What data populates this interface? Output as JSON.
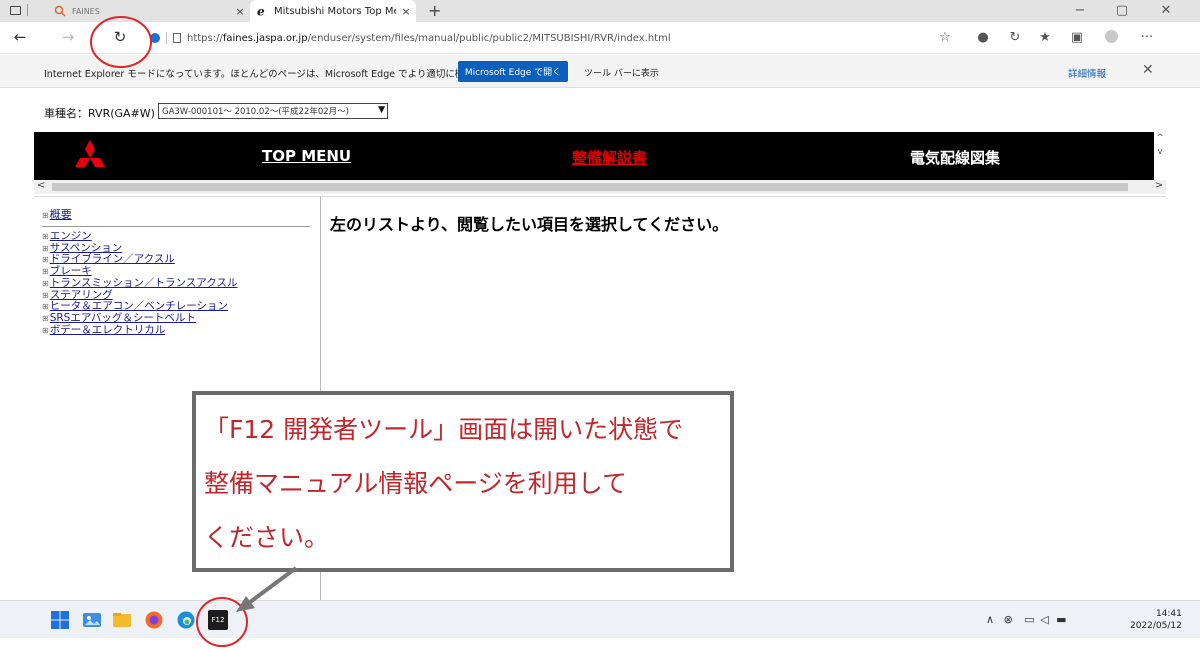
{
  "browser": {
    "tabs": [
      {
        "label": "FAINES",
        "active": false,
        "close": "×"
      },
      {
        "label": "Mitsubishi Motors Top Menu",
        "active": true,
        "close": "×"
      }
    ],
    "new_tab": "+",
    "window_controls": {
      "minimize": "−",
      "restore": "▢",
      "close": "✕"
    },
    "url_prefix": "https://",
    "url_host": "faines.jaspa.or.jp",
    "url_path": "/enduser/system/files/manual/public/public2/MITSUBISHI/RVR/index.html",
    "more_menu": "···"
  },
  "ie_bar": {
    "message": "Internet Explorer モードになっています。ほとんどのページは、Microsoft Edge でより適切に機能します。",
    "open_in_edge": "Microsoft Edge で開く",
    "show_in_toolbar": "ツール バーに表示",
    "more_info": "詳細情報",
    "close": "✕"
  },
  "vehicle": {
    "label": "車種名：RVR(GA#W)",
    "selected": "GA3W-000101～ 2010.02～(平成22年02月～)"
  },
  "header": {
    "top_menu": "TOP MENU",
    "seibi": "整備解説書",
    "denki": "電気配線図集"
  },
  "nav": {
    "head": "概要",
    "items": [
      "エンジン",
      "サスペンション",
      "ドライブライン／アクスル",
      "ブレーキ",
      "トランスミッション／トランスアクスル",
      "ステアリング",
      "ヒータ＆エアコン／ベンチレーション",
      "SRSエアバッグ＆シートベルト",
      "ボデー＆エレクトリカル"
    ]
  },
  "content": {
    "message": "左のリストより、閲覧したい項目を選択してください。"
  },
  "annotation": {
    "lines": [
      "「F12 開発者ツール」画面は開いた状態で",
      "整備マニュアル情報ページを利用して",
      "ください。"
    ],
    "color": "#c0282d"
  },
  "taskbar": {
    "f12_label": "F12",
    "time": "14:41",
    "date": "2022/05/12",
    "tray_chevron": "∧"
  }
}
